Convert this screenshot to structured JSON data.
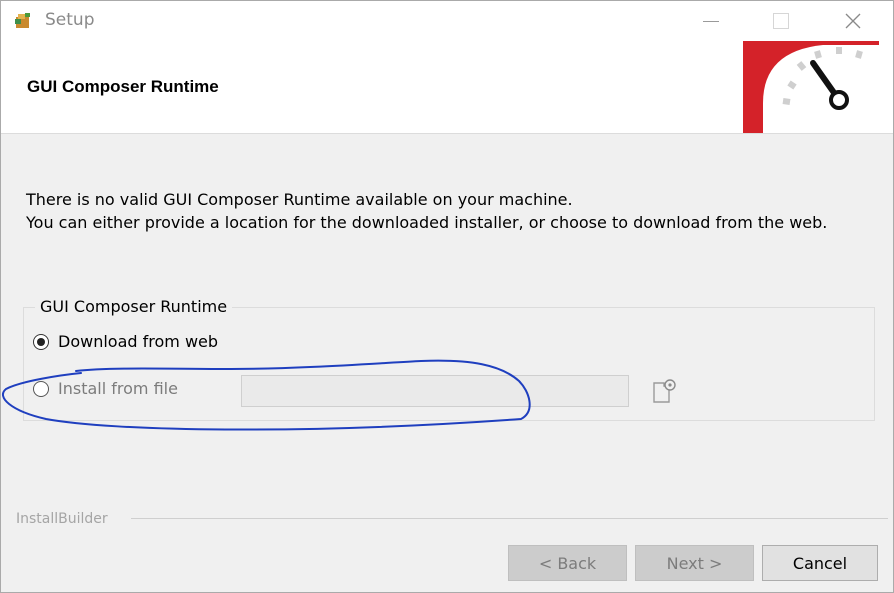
{
  "window": {
    "title": "Setup",
    "controls": {
      "minimize": "minimize-icon",
      "maximize": "maximize-icon",
      "close": "close-icon"
    }
  },
  "header": {
    "title": "GUI Composer Runtime",
    "logo": "speedometer-logo",
    "logo_color": "#d42229"
  },
  "message": {
    "line1": "There is no valid GUI Composer Runtime available on your machine.",
    "line2": "You can either provide a location for the downloaded installer, or choose to download from the web."
  },
  "group": {
    "label": "GUI Composer Runtime",
    "options": [
      {
        "label": "Download from web",
        "selected": true
      },
      {
        "label": "Install from file",
        "selected": false
      }
    ],
    "file_path_value": "",
    "browse_icon": "browse-file-icon"
  },
  "annotation": {
    "color": "#1f3fbf"
  },
  "footer": {
    "brand": "InstallBuilder",
    "back_label": "< Back",
    "next_label": "Next >",
    "cancel_label": "Cancel"
  }
}
